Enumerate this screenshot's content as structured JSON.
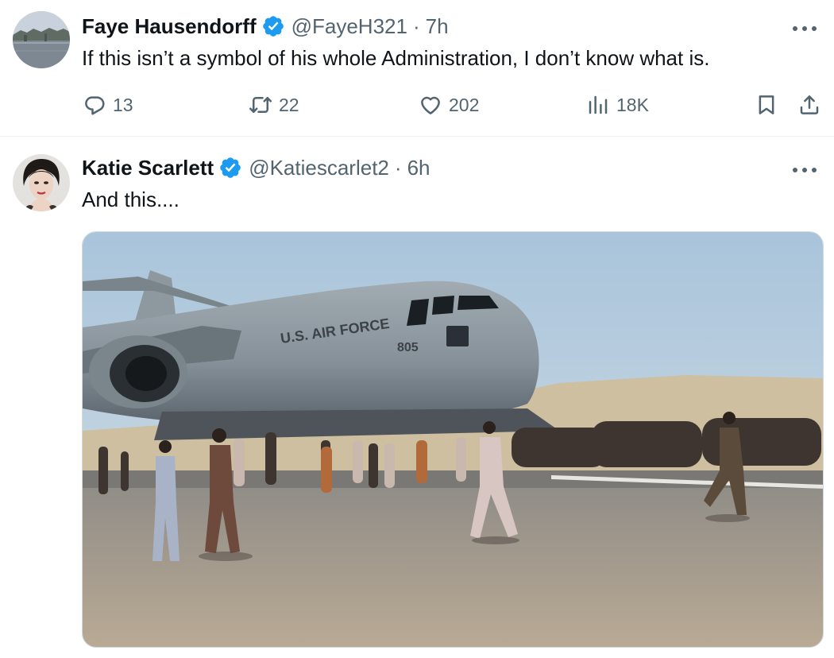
{
  "tweets": [
    {
      "author_name": "Faye Hausendorff",
      "handle": "@FayeH321",
      "separator": "·",
      "time": "7h",
      "text": "If this isn’t a symbol of his whole Administration, I don’t know what is.",
      "verified": true,
      "avatar_icon": "landscape-avatar",
      "stats": {
        "replies": "13",
        "retweets": "22",
        "likes": "202",
        "views": "18K"
      }
    },
    {
      "author_name": "Katie Scarlett",
      "handle": "@Katiescarlet2",
      "separator": "·",
      "time": "6h",
      "text": "And this....",
      "verified": true,
      "avatar_icon": "portrait-avatar",
      "media": {
        "type": "photo",
        "aircraft_marking": "U.S. AIR FORCE",
        "tail_number": "805"
      }
    }
  ],
  "colors": {
    "text_primary": "#0f1419",
    "text_secondary": "#536471",
    "verified_badge": "#1d9bf0",
    "divider": "#eff3f4"
  },
  "icons": {
    "reply": "reply-bubble-icon",
    "retweet": "retweet-icon",
    "like": "heart-icon",
    "views": "views-bar-chart-icon",
    "bookmark": "bookmark-icon",
    "share": "share-upload-icon",
    "more": "more-ellipsis-icon",
    "verified": "verified-badge-icon"
  }
}
